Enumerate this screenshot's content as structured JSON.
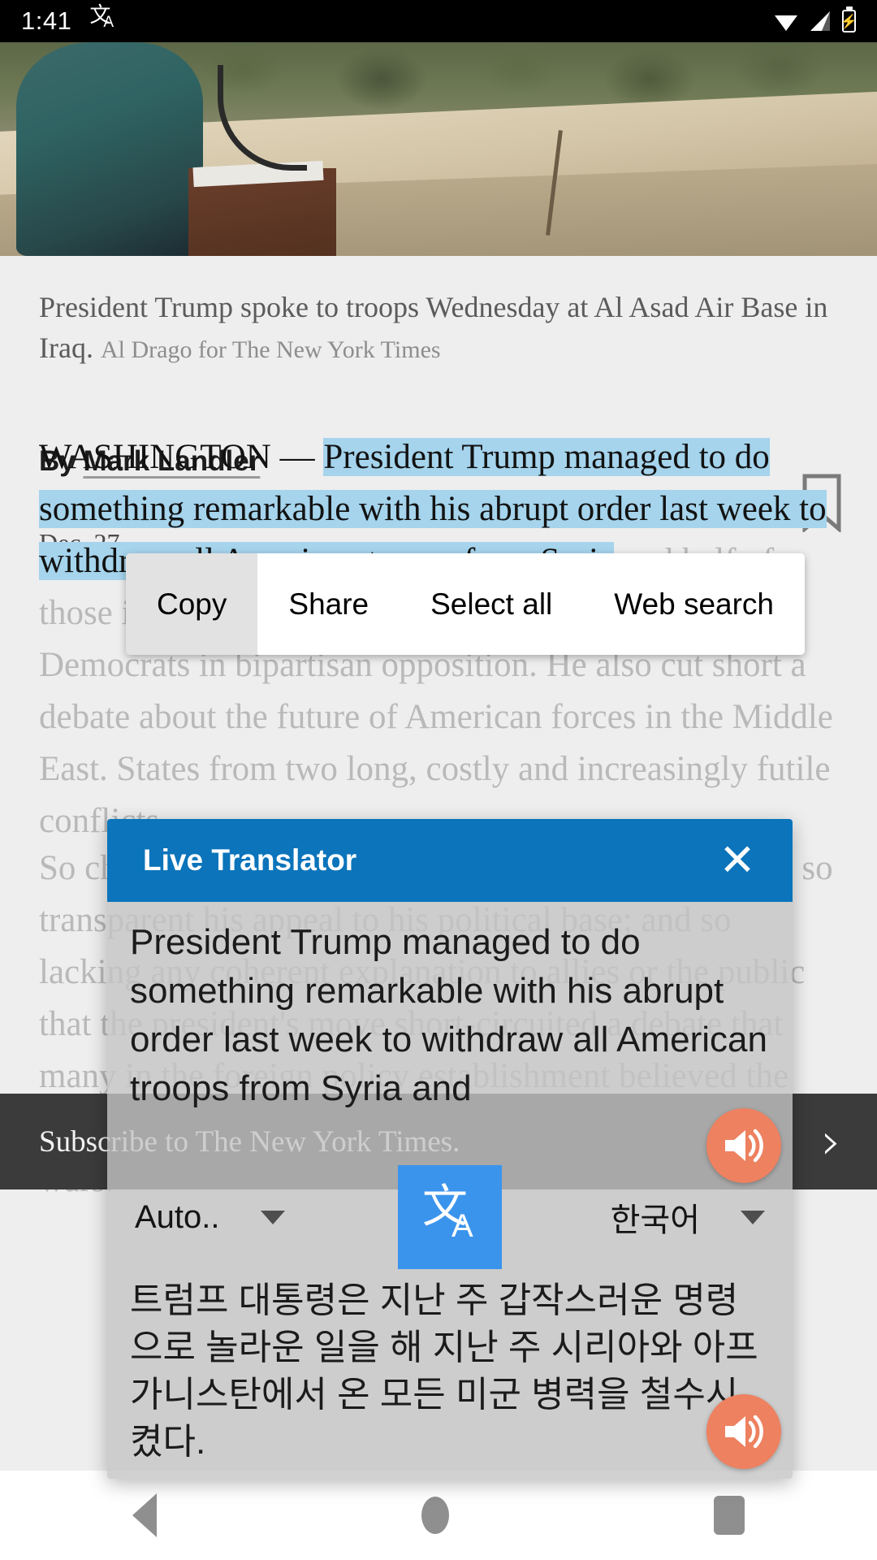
{
  "status_bar": {
    "time": "1:41",
    "translate_icon": "translate-icon",
    "wifi_icon": "wifi-icon",
    "signal_icon": "cellular-signal-icon",
    "battery_icon": "battery-charging-icon"
  },
  "article": {
    "photo_alt": "President Trump speaking at a podium to troops",
    "caption": "President Trump spoke to troops Wednesday at Al Asad Air Base in Iraq.",
    "caption_credit": "Al Drago for The New York Times",
    "byline_prefix": "By",
    "byline_author": "Mark Landler",
    "dateline": "Dec. 27",
    "bookmark_icon": "bookmark-icon",
    "paragraph_1": {
      "lead": "WASHINGTON — ",
      "highlighted": "President Trump managed to do something remarkable with his abrupt order last week to withdraw all American troops from Syria",
      "tail": " and half of those in Afghanistan: He united Republicans and Democrats in bipartisan opposition. He also cut short a debate about the future of American forces in the Middle East. States from two long, costly and increasingly futile conflicts."
    },
    "paragraph_2": "So chaotic was Mr. Trump's decision-making process; so transparent his appeal to his political base; and so lacking any coherent explanation to allies or the public that the president's move short-circuited a debate that many in the foreign policy establishment believed the nation needed to have about the future of America's wars."
  },
  "context_menu": {
    "items": [
      {
        "label": "Copy",
        "pressed": true
      },
      {
        "label": "Share",
        "pressed": false
      },
      {
        "label": "Select all",
        "pressed": false
      },
      {
        "label": "Web search",
        "pressed": false
      }
    ]
  },
  "subscribe_bar": {
    "label": "Subscribe to The New York Times.",
    "chevron": "›"
  },
  "translator": {
    "title": "Live Translator",
    "close_label": "✕",
    "source_text": "President Trump managed to do something remarkable with his abrupt order last week to withdraw all American troops from Syria and",
    "target_text": "트럼프 대통령은 지난 주 갑작스러운 명령으로 놀라운 일을 해 지난 주 시리아와 아프가니스탄에서 온 모든 미군 병력을 철수시켰다.",
    "source_language": "Auto..",
    "target_language": "한국어",
    "swap_button_icon": "translate-icon",
    "source_speak_icon": "speaker-icon",
    "target_speak_icon": "speaker-icon",
    "header_color": "#0b74bb",
    "swap_button_color": "#3b94ec",
    "speaker_color": "#ed8160"
  },
  "selection": {
    "handle_color": "#3367d6",
    "highlight_color": "#a5d4ec"
  },
  "nav_bar": {
    "back_icon": "back-triangle-icon",
    "home_icon": "home-circle-icon",
    "recents_icon": "recents-square-icon"
  }
}
